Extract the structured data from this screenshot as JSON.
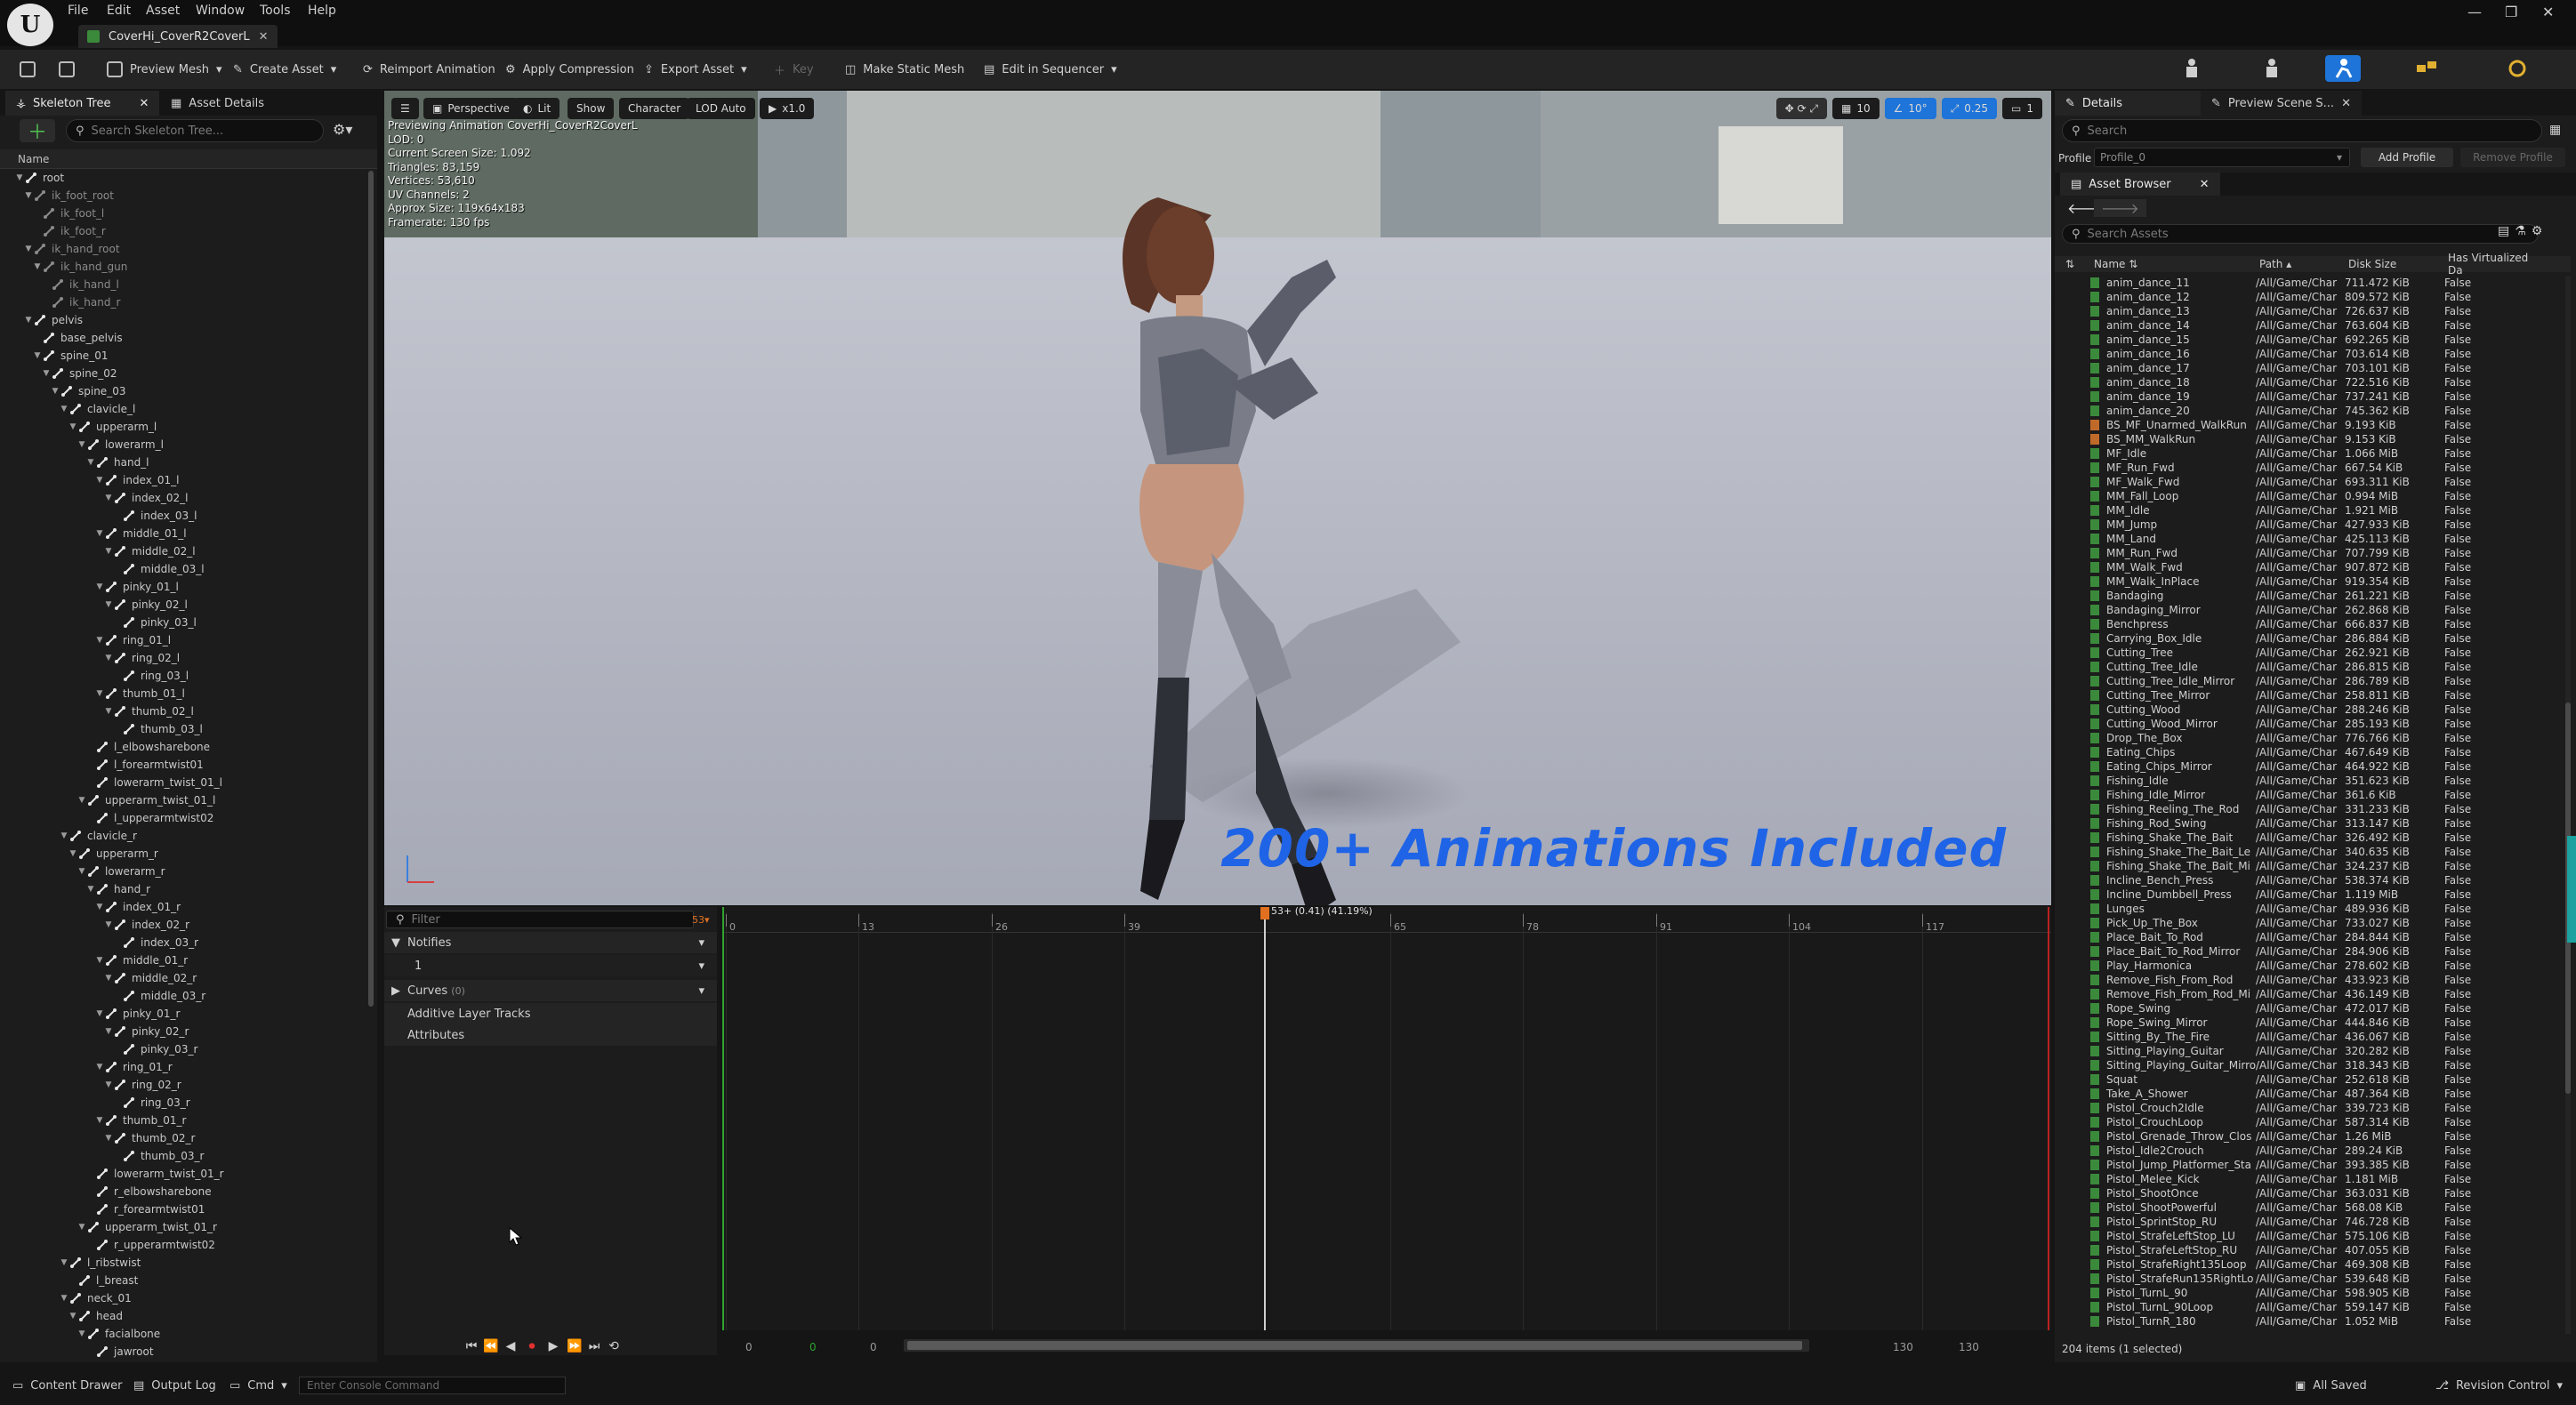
{
  "menu": [
    "File",
    "Edit",
    "Asset",
    "Window",
    "Tools",
    "Help"
  ],
  "document_tab": "CoverHi_CoverR2CoverL",
  "toolbar": {
    "preview_mesh": "Preview Mesh",
    "create_asset": "Create Asset",
    "reimport": "Reimport Animation",
    "apply_compression": "Apply Compression",
    "export_asset": "Export Asset",
    "key": "Key",
    "make_static_mesh": "Make Static Mesh",
    "edit_in_sequencer": "Edit in Sequencer"
  },
  "left_panel": {
    "tab_skeleton": "Skeleton Tree",
    "tab_asset_details": "Asset Details",
    "search_placeholder": "Search Skeleton Tree...",
    "column_name": "Name",
    "bones": [
      {
        "name": "root",
        "depth": 0,
        "open": true
      },
      {
        "name": "ik_foot_root",
        "depth": 1,
        "open": true,
        "dim": true
      },
      {
        "name": "ik_foot_l",
        "depth": 2,
        "dim": true
      },
      {
        "name": "ik_foot_r",
        "depth": 2,
        "dim": true
      },
      {
        "name": "ik_hand_root",
        "depth": 1,
        "open": true,
        "dim": true
      },
      {
        "name": "ik_hand_gun",
        "depth": 2,
        "open": true,
        "dim": true
      },
      {
        "name": "ik_hand_l",
        "depth": 3,
        "dim": true
      },
      {
        "name": "ik_hand_r",
        "depth": 3,
        "dim": true
      },
      {
        "name": "pelvis",
        "depth": 1,
        "open": true
      },
      {
        "name": "base_pelvis",
        "depth": 2
      },
      {
        "name": "spine_01",
        "depth": 2,
        "open": true
      },
      {
        "name": "spine_02",
        "depth": 3,
        "open": true
      },
      {
        "name": "spine_03",
        "depth": 4,
        "open": true
      },
      {
        "name": "clavicle_l",
        "depth": 5,
        "open": true
      },
      {
        "name": "upperarm_l",
        "depth": 6,
        "open": true
      },
      {
        "name": "lowerarm_l",
        "depth": 7,
        "open": true
      },
      {
        "name": "hand_l",
        "depth": 8,
        "open": true
      },
      {
        "name": "index_01_l",
        "depth": 9,
        "open": true
      },
      {
        "name": "index_02_l",
        "depth": 10,
        "open": true
      },
      {
        "name": "index_03_l",
        "depth": 11
      },
      {
        "name": "middle_01_l",
        "depth": 9,
        "open": true
      },
      {
        "name": "middle_02_l",
        "depth": 10,
        "open": true
      },
      {
        "name": "middle_03_l",
        "depth": 11
      },
      {
        "name": "pinky_01_l",
        "depth": 9,
        "open": true
      },
      {
        "name": "pinky_02_l",
        "depth": 10,
        "open": true
      },
      {
        "name": "pinky_03_l",
        "depth": 11
      },
      {
        "name": "ring_01_l",
        "depth": 9,
        "open": true
      },
      {
        "name": "ring_02_l",
        "depth": 10,
        "open": true
      },
      {
        "name": "ring_03_l",
        "depth": 11
      },
      {
        "name": "thumb_01_l",
        "depth": 9,
        "open": true
      },
      {
        "name": "thumb_02_l",
        "depth": 10,
        "open": true
      },
      {
        "name": "thumb_03_l",
        "depth": 11
      },
      {
        "name": "l_elbowsharebone",
        "depth": 8
      },
      {
        "name": "l_forearmtwist01",
        "depth": 8
      },
      {
        "name": "lowerarm_twist_01_l",
        "depth": 8
      },
      {
        "name": "upperarm_twist_01_l",
        "depth": 7,
        "open": true
      },
      {
        "name": "l_upperarmtwist02",
        "depth": 8
      },
      {
        "name": "clavicle_r",
        "depth": 5,
        "open": true
      },
      {
        "name": "upperarm_r",
        "depth": 6,
        "open": true
      },
      {
        "name": "lowerarm_r",
        "depth": 7,
        "open": true
      },
      {
        "name": "hand_r",
        "depth": 8,
        "open": true
      },
      {
        "name": "index_01_r",
        "depth": 9,
        "open": true
      },
      {
        "name": "index_02_r",
        "depth": 10,
        "open": true
      },
      {
        "name": "index_03_r",
        "depth": 11
      },
      {
        "name": "middle_01_r",
        "depth": 9,
        "open": true
      },
      {
        "name": "middle_02_r",
        "depth": 10,
        "open": true
      },
      {
        "name": "middle_03_r",
        "depth": 11
      },
      {
        "name": "pinky_01_r",
        "depth": 9,
        "open": true
      },
      {
        "name": "pinky_02_r",
        "depth": 10,
        "open": true
      },
      {
        "name": "pinky_03_r",
        "depth": 11
      },
      {
        "name": "ring_01_r",
        "depth": 9,
        "open": true
      },
      {
        "name": "ring_02_r",
        "depth": 10,
        "open": true
      },
      {
        "name": "ring_03_r",
        "depth": 11
      },
      {
        "name": "thumb_01_r",
        "depth": 9,
        "open": true
      },
      {
        "name": "thumb_02_r",
        "depth": 10,
        "open": true
      },
      {
        "name": "thumb_03_r",
        "depth": 11
      },
      {
        "name": "lowerarm_twist_01_r",
        "depth": 8
      },
      {
        "name": "r_elbowsharebone",
        "depth": 8
      },
      {
        "name": "r_forearmtwist01",
        "depth": 8
      },
      {
        "name": "upperarm_twist_01_r",
        "depth": 7,
        "open": true
      },
      {
        "name": "r_upperarmtwist02",
        "depth": 8
      },
      {
        "name": "l_ribstwist",
        "depth": 5,
        "open": true
      },
      {
        "name": "l_breast",
        "depth": 6
      },
      {
        "name": "neck_01",
        "depth": 5,
        "open": true
      },
      {
        "name": "head",
        "depth": 6,
        "open": true
      },
      {
        "name": "facialbone",
        "depth": 7,
        "open": true
      },
      {
        "name": "jawroot",
        "depth": 8
      }
    ]
  },
  "viewport": {
    "perspective": "Perspective",
    "lit": "Lit",
    "show": "Show",
    "character": "Character",
    "lod": "LOD Auto",
    "speed": "x1.0",
    "info_lines": [
      "Previewing Animation CoverHi_CoverR2CoverL",
      "LOD: 0",
      "Current Screen Size: 1.092",
      "Triangles: 83,159",
      "Vertices: 53,610",
      "UV Channels: 2",
      "Approx Size: 119x64x183",
      "Framerate: 130 fps"
    ],
    "right_icons": [
      "10",
      "10°",
      "0.25",
      "1"
    ],
    "promo_text": "200+ Animations Included"
  },
  "timeline": {
    "filter_placeholder": "Filter",
    "frame_badge": "53",
    "tracks": [
      "Notifies",
      "1",
      "Curves",
      "Additive Layer Tracks",
      "Attributes"
    ],
    "curves_count": "(0)",
    "ticks": [
      "0",
      "13",
      "26",
      "39",
      "53+ (0.41) (41.19%)",
      "65",
      "78",
      "91",
      "104",
      "117"
    ],
    "playhead_frame": 53,
    "total_frames": 130,
    "bottom_left_a": "0",
    "bottom_left_b": "0",
    "bottom_left_c": "0",
    "bottom_right_a": "130",
    "bottom_right_b": "130"
  },
  "right_panel": {
    "tab_details": "Details",
    "tab_preview": "Preview Scene S...",
    "search_placeholder": "Search",
    "profile_label": "Profile",
    "profile_value": "Profile_0",
    "add_profile": "Add Profile",
    "remove_profile": "Remove Profile",
    "asset_browser_tab": "Asset Browser",
    "search_assets_placeholder": "Search Assets",
    "columns": [
      "Name",
      "Path",
      "Disk Size",
      "Has Virtualized Da"
    ],
    "status": "204 items (1 selected)",
    "assets": [
      [
        "anim_dance_11",
        "711.472 KiB"
      ],
      [
        "anim_dance_12",
        "809.572 KiB"
      ],
      [
        "anim_dance_13",
        "726.637 KiB"
      ],
      [
        "anim_dance_14",
        "763.604 KiB"
      ],
      [
        "anim_dance_15",
        "692.265 KiB"
      ],
      [
        "anim_dance_16",
        "703.614 KiB"
      ],
      [
        "anim_dance_17",
        "703.101 KiB"
      ],
      [
        "anim_dance_18",
        "722.516 KiB"
      ],
      [
        "anim_dance_19",
        "737.241 KiB"
      ],
      [
        "anim_dance_20",
        "745.362 KiB"
      ],
      [
        "BS_MF_Unarmed_WalkRun",
        "9.193 KiB",
        "or"
      ],
      [
        "BS_MM_WalkRun",
        "9.153 KiB",
        "or"
      ],
      [
        "MF_Idle",
        "1.066 MiB"
      ],
      [
        "MF_Run_Fwd",
        "667.54 KiB"
      ],
      [
        "MF_Walk_Fwd",
        "693.311 KiB"
      ],
      [
        "MM_Fall_Loop",
        "0.994 MiB"
      ],
      [
        "MM_Idle",
        "1.921 MiB"
      ],
      [
        "MM_Jump",
        "427.933 KiB"
      ],
      [
        "MM_Land",
        "425.113 KiB"
      ],
      [
        "MM_Run_Fwd",
        "707.799 KiB"
      ],
      [
        "MM_Walk_Fwd",
        "907.872 KiB"
      ],
      [
        "MM_Walk_InPlace",
        "919.354 KiB"
      ],
      [
        "Bandaging",
        "261.221 KiB"
      ],
      [
        "Bandaging_Mirror",
        "262.868 KiB"
      ],
      [
        "Benchpress",
        "666.837 KiB"
      ],
      [
        "Carrying_Box_Idle",
        "286.884 KiB"
      ],
      [
        "Cutting_Tree",
        "262.921 KiB"
      ],
      [
        "Cutting_Tree_Idle",
        "286.815 KiB"
      ],
      [
        "Cutting_Tree_Idle_Mirror",
        "286.789 KiB"
      ],
      [
        "Cutting_Tree_Mirror",
        "258.811 KiB"
      ],
      [
        "Cutting_Wood",
        "288.246 KiB"
      ],
      [
        "Cutting_Wood_Mirror",
        "285.193 KiB"
      ],
      [
        "Drop_The_Box",
        "776.766 KiB"
      ],
      [
        "Eating_Chips",
        "467.649 KiB"
      ],
      [
        "Eating_Chips_Mirror",
        "464.922 KiB"
      ],
      [
        "Fishing_Idle",
        "351.623 KiB"
      ],
      [
        "Fishing_Idle_Mirror",
        "361.6 KiB"
      ],
      [
        "Fishing_Reeling_The_Rod",
        "331.233 KiB"
      ],
      [
        "Fishing_Rod_Swing",
        "313.147 KiB"
      ],
      [
        "Fishing_Shake_The_Bait",
        "326.492 KiB"
      ],
      [
        "Fishing_Shake_The_Bait_Le",
        "340.635 KiB"
      ],
      [
        "Fishing_Shake_The_Bait_Mi",
        "324.237 KiB"
      ],
      [
        "Incline_Bench_Press",
        "538.374 KiB"
      ],
      [
        "Incline_Dumbbell_Press",
        "1.119 MiB"
      ],
      [
        "Lunges",
        "489.936 KiB"
      ],
      [
        "Pick_Up_The_Box",
        "733.027 KiB"
      ],
      [
        "Place_Bait_To_Rod",
        "284.844 KiB"
      ],
      [
        "Place_Bait_To_Rod_Mirror",
        "284.906 KiB"
      ],
      [
        "Play_Harmonica",
        "278.602 KiB"
      ],
      [
        "Remove_Fish_From_Rod",
        "433.923 KiB"
      ],
      [
        "Remove_Fish_From_Rod_Mi",
        "436.149 KiB"
      ],
      [
        "Rope_Swing",
        "472.017 KiB"
      ],
      [
        "Rope_Swing_Mirror",
        "444.846 KiB"
      ],
      [
        "Sitting_By_The_Fire",
        "436.067 KiB"
      ],
      [
        "Sitting_Playing_Guitar",
        "320.282 KiB"
      ],
      [
        "Sitting_Playing_Guitar_Mirro",
        "318.343 KiB"
      ],
      [
        "Squat",
        "252.618 KiB"
      ],
      [
        "Take_A_Shower",
        "487.364 KiB"
      ],
      [
        "Pistol_Crouch2Idle",
        "339.723 KiB"
      ],
      [
        "Pistol_CrouchLoop",
        "587.314 KiB"
      ],
      [
        "Pistol_Grenade_Throw_Clos",
        "1.26 MiB"
      ],
      [
        "Pistol_Idle2Crouch",
        "289.24 KiB"
      ],
      [
        "Pistol_Jump_Platformer_Sta",
        "393.385 KiB"
      ],
      [
        "Pistol_Melee_Kick",
        "1.181 MiB"
      ],
      [
        "Pistol_ShootOnce",
        "363.031 KiB"
      ],
      [
        "Pistol_ShootPowerful",
        "568.08 KiB"
      ],
      [
        "Pistol_SprintStop_RU",
        "746.728 KiB"
      ],
      [
        "Pistol_StrafeLeftStop_LU",
        "575.106 KiB"
      ],
      [
        "Pistol_StrafeLeftStop_RU",
        "407.055 KiB"
      ],
      [
        "Pistol_StrafeRight135Loop",
        "469.308 KiB"
      ],
      [
        "Pistol_StrafeRun135RightLo",
        "539.648 KiB"
      ],
      [
        "Pistol_TurnL_90",
        "598.905 KiB"
      ],
      [
        "Pistol_TurnL_90Loop",
        "559.147 KiB"
      ],
      [
        "Pistol_TurnR_180",
        "1.052 MiB"
      ]
    ],
    "asset_path": "/All/Game/Char",
    "asset_virtualized": "False"
  },
  "statusbar": {
    "content_drawer": "Content Drawer",
    "output_log": "Output Log",
    "cmd": "Cmd",
    "console_placeholder": "Enter Console Command",
    "all_saved": "All Saved",
    "revision_control": "Revision Control"
  }
}
